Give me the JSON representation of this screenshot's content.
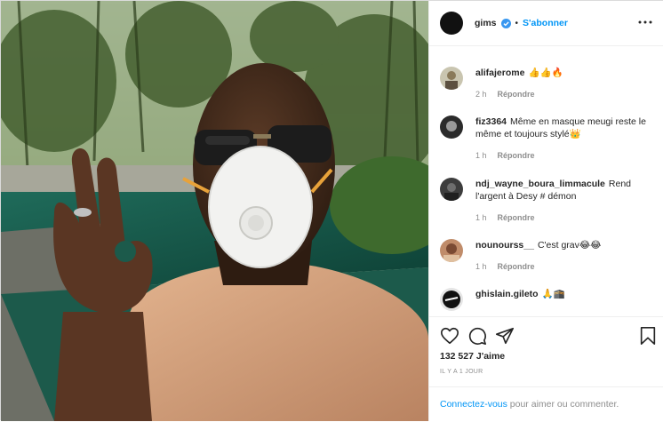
{
  "post": {
    "username": "gims",
    "follow_label": "S'abonner",
    "separator": "•",
    "verified_icon": "verified-badge-icon",
    "more_icon": "more-options-icon",
    "likes": "132 527 J'aime",
    "timestamp": "IL Y A 1 JOUR",
    "login_link": "Connectez-vous",
    "login_rest": " pour aimer ou commenter."
  },
  "comments": [
    {
      "user": "alifajerome",
      "text": "👍👍🔥",
      "age": "2 h",
      "reply": "Répondre"
    },
    {
      "user": "fiz3364",
      "text": "Même en masque meugi reste le même et toujours stylé👑",
      "age": "1 h",
      "reply": "Répondre"
    },
    {
      "user": "ndj_wayne_boura_limmacule",
      "text": "Rend l'argent à Desy # démon",
      "age": "1 h",
      "reply": "Répondre"
    },
    {
      "user": "nounourss__",
      "text": "C'est grav😂😂",
      "age": "1 h",
      "reply": "Répondre"
    },
    {
      "user": "ghislain.gileto",
      "text": "🙏🕋",
      "age": "",
      "reply": ""
    }
  ],
  "icons": {
    "like": "heart-icon",
    "comment": "comment-bubble-icon",
    "share": "paper-plane-icon",
    "save": "bookmark-icon"
  },
  "colors": {
    "accent": "#0095f6",
    "muted": "#8e8e8e",
    "text": "#262626"
  }
}
